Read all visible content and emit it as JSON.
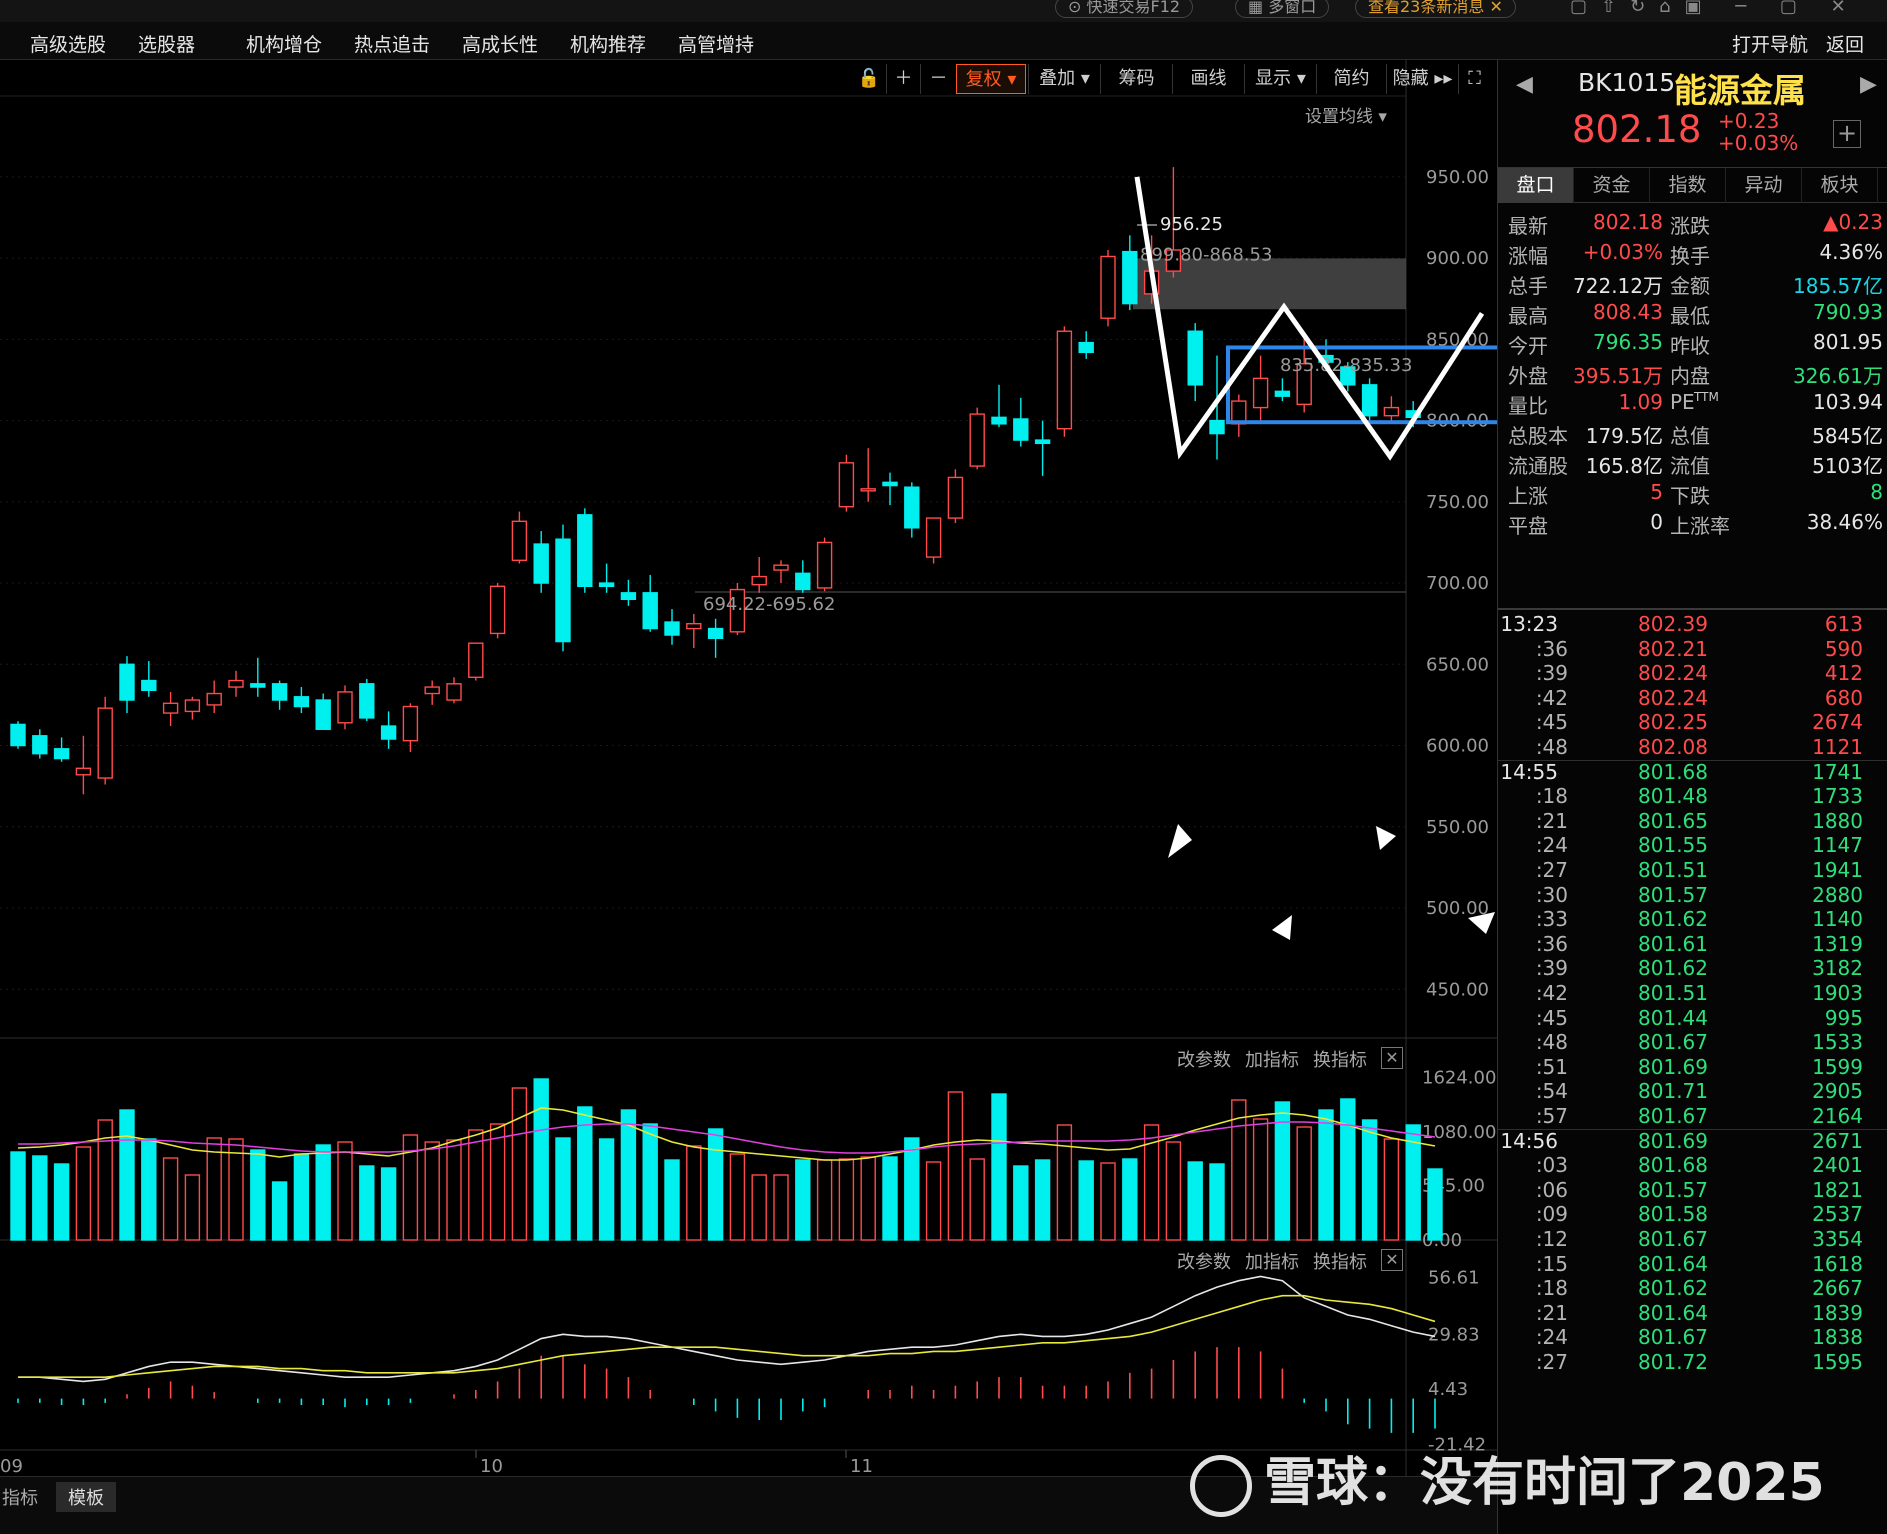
{
  "topstrip": {
    "items": [
      "快速交易F12",
      "多窗口",
      "查看23条新消息"
    ]
  },
  "menubar": {
    "items": [
      "高级选股",
      "选股器",
      "机构增仓",
      "热点追击",
      "高成长性",
      "机构推荐",
      "高管增持"
    ],
    "right_items": [
      "打开导航",
      "返回"
    ]
  },
  "toolbar": {
    "buttons": [
      "复权",
      "叠加",
      "筹码",
      "画线",
      "显示",
      "简约",
      "隐藏"
    ],
    "ma_setting": "设置均线"
  },
  "indicator_controls": [
    "改参数",
    "加指标",
    "换指标"
  ],
  "chart_data": [
    {
      "type": "candlestick",
      "name": "K线",
      "ylim": [
        420,
        985
      ],
      "yticks": [
        "950.00",
        "900.00",
        "850.00",
        "800.00",
        "750.00",
        "700.00",
        "650.00",
        "600.00",
        "550.00",
        "500.00",
        "450.00"
      ],
      "xlabels": [
        "09",
        "10",
        "11"
      ],
      "annotations": [
        "956.25",
        "899.80-868.53",
        "835.82-835.33",
        "694.22-695.62"
      ],
      "ohlc": [
        [
          613,
          615,
          598,
          600
        ],
        [
          606,
          610,
          592,
          595
        ],
        [
          598,
          605,
          590,
          592
        ],
        [
          582,
          606,
          570,
          586
        ],
        [
          580,
          630,
          576,
          623
        ],
        [
          650,
          655,
          620,
          628
        ],
        [
          640,
          652,
          630,
          634
        ],
        [
          620,
          633,
          612,
          626
        ],
        [
          621,
          630,
          616,
          628
        ],
        [
          625,
          640,
          620,
          632
        ],
        [
          636,
          646,
          630,
          640
        ],
        [
          638,
          654,
          630,
          636
        ],
        [
          638,
          640,
          622,
          628
        ],
        [
          630,
          636,
          620,
          624
        ],
        [
          628,
          632,
          610,
          610
        ],
        [
          614,
          637,
          610,
          633
        ],
        [
          638,
          641,
          615,
          617
        ],
        [
          612,
          621,
          598,
          604
        ],
        [
          603,
          626,
          596,
          624
        ],
        [
          632,
          640,
          625,
          636
        ],
        [
          628,
          642,
          626,
          638
        ],
        [
          642,
          662,
          640,
          663
        ],
        [
          669,
          700,
          666,
          698
        ],
        [
          714,
          744,
          712,
          738
        ],
        [
          724,
          732,
          694,
          700
        ],
        [
          727,
          736,
          658,
          664
        ],
        [
          742,
          746,
          694,
          698
        ],
        [
          700,
          712,
          694,
          698
        ],
        [
          694,
          702,
          686,
          690
        ],
        [
          694,
          705,
          670,
          672
        ],
        [
          676,
          684,
          662,
          668
        ],
        [
          672,
          681,
          660,
          675
        ],
        [
          672,
          678,
          654,
          666
        ],
        [
          670,
          700,
          668,
          696
        ],
        [
          699,
          716,
          694,
          704
        ],
        [
          708,
          714,
          700,
          711
        ],
        [
          706,
          714,
          694,
          696
        ],
        [
          697,
          728,
          695,
          725
        ],
        [
          747,
          779,
          744,
          774
        ],
        [
          758,
          783,
          750,
          758
        ],
        [
          762,
          768,
          748,
          760
        ],
        [
          759,
          762,
          728,
          734
        ],
        [
          716,
          740,
          712,
          740
        ],
        [
          740,
          770,
          737,
          765
        ],
        [
          772,
          808,
          770,
          804
        ],
        [
          802,
          822,
          796,
          798
        ],
        [
          801,
          814,
          784,
          788
        ],
        [
          788,
          800,
          766,
          786
        ],
        [
          795,
          858,
          790,
          855
        ],
        [
          848,
          855,
          838,
          842
        ],
        [
          863,
          905,
          858,
          901
        ],
        [
          904,
          914,
          868,
          872
        ],
        [
          878,
          914,
          872,
          892
        ],
        [
          892,
          956,
          888,
          905
        ],
        [
          855,
          860,
          812,
          822
        ],
        [
          800,
          840,
          776,
          792
        ],
        [
          798,
          816,
          790,
          812
        ],
        [
          808,
          840,
          800,
          826
        ],
        [
          818,
          826,
          812,
          815
        ],
        [
          810,
          850,
          805,
          835
        ],
        [
          840,
          850,
          832,
          836
        ],
        [
          833,
          836,
          818,
          822
        ],
        [
          822,
          826,
          800,
          803
        ],
        [
          803,
          815,
          798,
          808
        ],
        [
          806,
          812,
          796,
          802
        ]
      ]
    },
    {
      "type": "bar",
      "name": "成交量",
      "ylim": [
        0,
        1700
      ],
      "yticks": [
        "1624.00",
        "1080.00",
        "545.00",
        "0.00"
      ],
      "values": [
        880,
        840,
        760,
        930,
        1200,
        1300,
        1010,
        820,
        650,
        1020,
        1010,
        900,
        580,
        860,
        950,
        980,
        740,
        720,
        1050,
        980,
        1000,
        1100,
        1160,
        1520,
        1610,
        1020,
        1330,
        1010,
        1300,
        1160,
        800,
        940,
        1110,
        860,
        650,
        650,
        800,
        800,
        810,
        830,
        830,
        1020,
        780,
        1480,
        810,
        1460,
        740,
        800,
        1150,
        790,
        770,
        810,
        1150,
        980,
        780,
        760,
        1400,
        1210,
        1380,
        1130,
        1300,
        1410,
        1200,
        1010,
        1150,
        710
      ],
      "ma5": [
        920,
        930,
        950,
        980,
        1020,
        1040,
        1000,
        950,
        900,
        880,
        870,
        860,
        830,
        860,
        870,
        880,
        860,
        840,
        880,
        920,
        990,
        1050,
        1120,
        1220,
        1320,
        1300,
        1250,
        1200,
        1150,
        1060,
        980,
        930,
        900,
        880,
        860,
        840,
        820,
        800,
        800,
        820,
        860,
        900,
        950,
        980,
        1000,
        990,
        970,
        960,
        940,
        920,
        900,
        910,
        970,
        1030,
        1100,
        1160,
        1220,
        1250,
        1270,
        1250,
        1210,
        1150,
        1080,
        1020,
        980,
        940
      ],
      "ma10": [
        960,
        960,
        970,
        980,
        990,
        1000,
        1000,
        990,
        970,
        960,
        950,
        930,
        910,
        890,
        880,
        880,
        880,
        880,
        890,
        910,
        940,
        980,
        1020,
        1060,
        1100,
        1130,
        1150,
        1160,
        1160,
        1140,
        1110,
        1080,
        1050,
        1010,
        970,
        930,
        900,
        880,
        870,
        870,
        880,
        900,
        930,
        950,
        960,
        970,
        980,
        990,
        990,
        990,
        990,
        1000,
        1020,
        1050,
        1080,
        1110,
        1140,
        1160,
        1180,
        1180,
        1170,
        1150,
        1120,
        1090,
        1060,
        1030
      ]
    },
    {
      "type": "line",
      "name": "MACD",
      "ylim": [
        -24,
        60
      ],
      "yticks": [
        "56.61",
        "29.83",
        "4.43",
        "-21.42"
      ],
      "dif": [
        10,
        10,
        9,
        8,
        9,
        12,
        15,
        17,
        17,
        16,
        15,
        14,
        13,
        12,
        11,
        10,
        10,
        10,
        11,
        12,
        13,
        15,
        18,
        23,
        28,
        30,
        29,
        29,
        28,
        26,
        24,
        22,
        20,
        18,
        17,
        16,
        17,
        18,
        20,
        22,
        23,
        24,
        24,
        25,
        27,
        29,
        30,
        29,
        29,
        30,
        32,
        35,
        38,
        43,
        48,
        52,
        55,
        57,
        55,
        47,
        43,
        39,
        37,
        34,
        31,
        29
      ],
      "dea": [
        10,
        10,
        10,
        10,
        10,
        11,
        12,
        13,
        14,
        15,
        15,
        15,
        14,
        14,
        13,
        13,
        12,
        12,
        12,
        12,
        12,
        13,
        14,
        16,
        18,
        20,
        21,
        22,
        23,
        24,
        24,
        24,
        24,
        23,
        22,
        21,
        20,
        20,
        20,
        20,
        21,
        21,
        22,
        22,
        23,
        24,
        25,
        26,
        26,
        27,
        28,
        29,
        31,
        34,
        37,
        40,
        43,
        46,
        48,
        48,
        46,
        45,
        44,
        42,
        39,
        36
      ],
      "hist": [
        -2,
        -2,
        -3,
        -3,
        -2,
        2,
        5,
        8,
        6,
        3,
        0,
        -2,
        -2,
        -3,
        -3,
        -4,
        -3,
        -3,
        -2,
        0,
        2,
        4,
        8,
        14,
        20,
        20,
        16,
        14,
        10,
        4,
        0,
        -3,
        -6,
        -9,
        -10,
        -10,
        -6,
        -4,
        0,
        4,
        4,
        6,
        4,
        6,
        8,
        10,
        10,
        6,
        6,
        6,
        8,
        12,
        14,
        18,
        22,
        24,
        24,
        22,
        14,
        -2,
        -6,
        -12,
        -14,
        -16,
        -16,
        -14
      ]
    }
  ],
  "panel": {
    "code": "BK1015",
    "name": "能源金属",
    "price": "802.18",
    "change": "+0.23",
    "change_pct": "+0.03%",
    "tabs": [
      "盘口",
      "资金",
      "指数",
      "异动",
      "板块"
    ],
    "quote_rows": [
      {
        "l1": "最新",
        "v1": "802.18",
        "c1": "#ff4b4b",
        "l2": "涨跌",
        "v2": "▲0.23",
        "c2": "#ff4b4b"
      },
      {
        "l1": "涨幅",
        "v1": "+0.03%",
        "c1": "#ff4b4b",
        "l2": "换手",
        "v2": "4.36%",
        "c2": "#e6e6e6"
      },
      {
        "l1": "总手",
        "v1": "722.12万",
        "c1": "#e6e6e6",
        "l2": "金额",
        "v2": "185.57亿",
        "c2": "#19d6e6"
      },
      {
        "l1": "最高",
        "v1": "808.43",
        "c1": "#ff4b4b",
        "l2": "最低",
        "v2": "790.93",
        "c2": "#2ee07a"
      },
      {
        "l1": "今开",
        "v1": "796.35",
        "c1": "#2ee07a",
        "l2": "昨收",
        "v2": "801.95",
        "c2": "#e6e6e6"
      },
      {
        "l1": "外盘",
        "v1": "395.51万",
        "c1": "#ff4b4b",
        "l2": "内盘",
        "v2": "326.61万",
        "c2": "#2ee07a"
      },
      {
        "l1": "量比",
        "v1": "1.09",
        "c1": "#ff4b4b",
        "l2": "PE",
        "v2": "103.94",
        "c2": "#e6e6e6"
      },
      {
        "l1": "总股本",
        "v1": "179.5亿",
        "c1": "#e6e6e6",
        "l2": "总值",
        "v2": "5845亿",
        "c2": "#e6e6e6"
      },
      {
        "l1": "流通股",
        "v1": "165.8亿",
        "c1": "#e6e6e6",
        "l2": "流值",
        "v2": "5103亿",
        "c2": "#e6e6e6"
      },
      {
        "l1": "上涨",
        "v1": "5",
        "c1": "#ff4b4b",
        "l2": "下跌",
        "v2": "8",
        "c2": "#2ee07a"
      },
      {
        "l1": "平盘",
        "v1": "0",
        "c1": "#e6e6e6",
        "l2": "上涨率",
        "v2": "38.46%",
        "c2": "#e6e6e6"
      }
    ],
    "pe_sup": "TTM",
    "ticks": [
      {
        "t": "13:23",
        "p": "802.39",
        "v": "613",
        "c": "#ff4b4b",
        "head": true
      },
      {
        "t": ":36",
        "p": "802.21",
        "v": "590",
        "c": "#ff4b4b"
      },
      {
        "t": ":39",
        "p": "802.24",
        "v": "412",
        "c": "#ff4b4b"
      },
      {
        "t": ":42",
        "p": "802.24",
        "v": "680",
        "c": "#ff4b4b"
      },
      {
        "t": ":45",
        "p": "802.25",
        "v": "2674",
        "c": "#ff4b4b"
      },
      {
        "t": ":48",
        "p": "802.08",
        "v": "1121",
        "c": "#ff4b4b"
      },
      {
        "t": "14:55",
        "p": "801.68",
        "v": "1741",
        "c": "#2ee07a",
        "head": true
      },
      {
        "t": ":18",
        "p": "801.48",
        "v": "1733",
        "c": "#2ee07a"
      },
      {
        "t": ":21",
        "p": "801.65",
        "v": "1880",
        "c": "#2ee07a"
      },
      {
        "t": ":24",
        "p": "801.55",
        "v": "1147",
        "c": "#2ee07a"
      },
      {
        "t": ":27",
        "p": "801.51",
        "v": "1941",
        "c": "#2ee07a"
      },
      {
        "t": ":30",
        "p": "801.57",
        "v": "2880",
        "c": "#2ee07a"
      },
      {
        "t": ":33",
        "p": "801.62",
        "v": "1140",
        "c": "#2ee07a"
      },
      {
        "t": ":36",
        "p": "801.61",
        "v": "1319",
        "c": "#2ee07a"
      },
      {
        "t": ":39",
        "p": "801.62",
        "v": "3182",
        "c": "#2ee07a"
      },
      {
        "t": ":42",
        "p": "801.51",
        "v": "1903",
        "c": "#2ee07a"
      },
      {
        "t": ":45",
        "p": "801.44",
        "v": "995",
        "c": "#2ee07a"
      },
      {
        "t": ":48",
        "p": "801.67",
        "v": "1533",
        "c": "#2ee07a"
      },
      {
        "t": ":51",
        "p": "801.69",
        "v": "1599",
        "c": "#2ee07a"
      },
      {
        "t": ":54",
        "p": "801.71",
        "v": "2905",
        "c": "#2ee07a"
      },
      {
        "t": ":57",
        "p": "801.67",
        "v": "2164",
        "c": "#2ee07a"
      },
      {
        "t": "14:56",
        "p": "801.69",
        "v": "2671",
        "c": "#2ee07a",
        "head": true
      },
      {
        "t": ":03",
        "p": "801.68",
        "v": "2401",
        "c": "#2ee07a"
      },
      {
        "t": ":06",
        "p": "801.57",
        "v": "1821",
        "c": "#2ee07a"
      },
      {
        "t": ":09",
        "p": "801.58",
        "v": "2537",
        "c": "#2ee07a"
      },
      {
        "t": ":12",
        "p": "801.67",
        "v": "3354",
        "c": "#2ee07a"
      },
      {
        "t": ":15",
        "p": "801.64",
        "v": "1618",
        "c": "#2ee07a"
      },
      {
        "t": ":18",
        "p": "801.62",
        "v": "2667",
        "c": "#2ee07a"
      },
      {
        "t": ":21",
        "p": "801.64",
        "v": "1839",
        "c": "#2ee07a"
      },
      {
        "t": ":24",
        "p": "801.67",
        "v": "1838",
        "c": "#2ee07a"
      },
      {
        "t": ":27",
        "p": "801.72",
        "v": "1595",
        "c": "#2ee07a"
      }
    ]
  },
  "bottombar": {
    "tabs": [
      "指标",
      "模板"
    ]
  },
  "watermark": "雪球：没有时间了2025",
  "colors": {
    "up": "#ff4b4b",
    "down": "#00f0f0",
    "box": "#2f86e6",
    "ma_yellow": "#e8e83a",
    "ma_magenta": "#e040e0"
  }
}
